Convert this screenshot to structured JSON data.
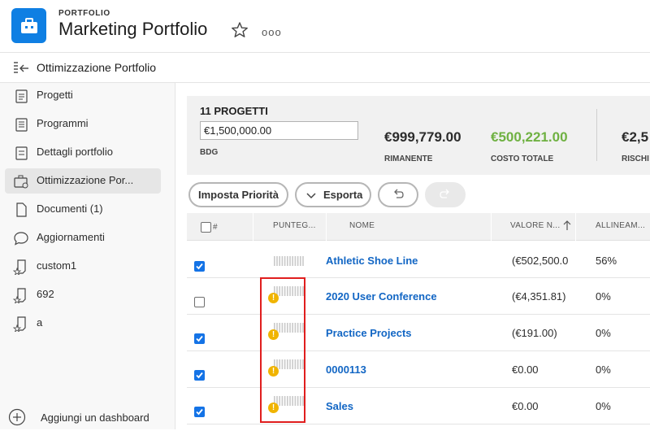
{
  "header": {
    "supertitle": "PORTFOLIO",
    "title": "Marketing Portfolio",
    "more": "ooo"
  },
  "subheader": {
    "title": "Ottimizzazione Portfolio"
  },
  "sidebar": {
    "items": [
      {
        "label": "Progetti",
        "icon": "projects-list-icon"
      },
      {
        "label": "Programmi",
        "icon": "programs-icon"
      },
      {
        "label": "Dettagli portfolio",
        "icon": "details-icon"
      },
      {
        "label": "Ottimizzazione Por...",
        "icon": "optimization-icon"
      },
      {
        "label": "Documenti (1)",
        "icon": "document-icon"
      },
      {
        "label": "Aggiornamenti",
        "icon": "chat-bubble-icon"
      },
      {
        "label": "custom1",
        "icon": "custom-dashboard-icon"
      },
      {
        "label": "692",
        "icon": "custom-dashboard-icon"
      },
      {
        "label": "a",
        "icon": "custom-dashboard-icon"
      }
    ],
    "active_index": 3,
    "add_dashboard": "Aggiungi un dashboard"
  },
  "summary": {
    "count": "11 PROGETTI",
    "budget_value": "€1,500,000.00",
    "budget_label": "BDG",
    "remaining_value": "€999,779.00",
    "remaining_label": "RIMANENTE",
    "total_cost_value": "€500,221.00",
    "total_cost_label": "COSTO TOTALE",
    "risk_value": "€2,5",
    "risk_label": "RISCHI",
    "accent_green": "#6fb142"
  },
  "toolbar": {
    "set_priority": "Imposta Priorità",
    "export": "Esporta"
  },
  "table": {
    "headers": {
      "hash": "#",
      "score": "PUNTEG...",
      "name": "NOME",
      "value": "VALORE N...",
      "alignment": "ALLINEAM..."
    },
    "rows": [
      {
        "checked": true,
        "warning": false,
        "name": "Athletic Shoe Line",
        "value": "(€502,500.0",
        "alignment": "56%"
      },
      {
        "checked": false,
        "warning": true,
        "name": "2020 User Conference",
        "value": "(€4,351.81)",
        "alignment": "0%"
      },
      {
        "checked": true,
        "warning": true,
        "name": "Practice Projects",
        "value": "(€191.00)",
        "alignment": "0%"
      },
      {
        "checked": true,
        "warning": true,
        "name": "0000113",
        "value": "€0.00",
        "alignment": "0%"
      },
      {
        "checked": true,
        "warning": true,
        "name": "Sales",
        "value": "€0.00",
        "alignment": "0%"
      }
    ]
  },
  "colors": {
    "brand_blue": "#0f7fe3",
    "link_blue": "#1266c4",
    "checkbox_blue": "#1473e6",
    "warning": "#f0b400",
    "highlight_red": "#e01e1e"
  }
}
